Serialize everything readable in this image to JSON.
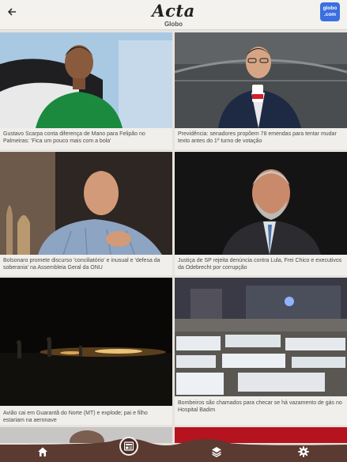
{
  "header": {
    "title": "Acta",
    "subtitle": "Globo",
    "brand_line1": "globo",
    "brand_line2": ".com"
  },
  "articles": [
    {
      "caption": "Gustavo Scarpa conta diferença de Mano para Felipão no Palmeiras: 'Fica um pouco mais com a bola'"
    },
    {
      "caption": "Previdência: senadores propõem 78 emendas para tentar mudar texto antes do 1º turno de votação"
    },
    {
      "caption": "Bolsonaro promete discurso 'conciliatório' e inusual e 'defesa da soberania' na Assembleia Geral da ONU"
    },
    {
      "caption": "Justiça de SP rejeita denúncia contra Lula, Frei Chico e executivos da Odebrecht por corrupção"
    },
    {
      "caption": "Avião cai em Guarantã do Norte (MT) e explode; pai e filho estariam na aeronave"
    },
    {
      "caption": "Bombeiros são chamados para checar se há vazamento de gás no Hospital Badim"
    }
  ],
  "nav": {
    "items": [
      "home-icon",
      "news-icon",
      "layers-icon",
      "settings-icon"
    ]
  },
  "colors": {
    "nav_bg": "#5a3a31",
    "nav_active": "#4a2e26",
    "brand": "#3b6fe0"
  }
}
